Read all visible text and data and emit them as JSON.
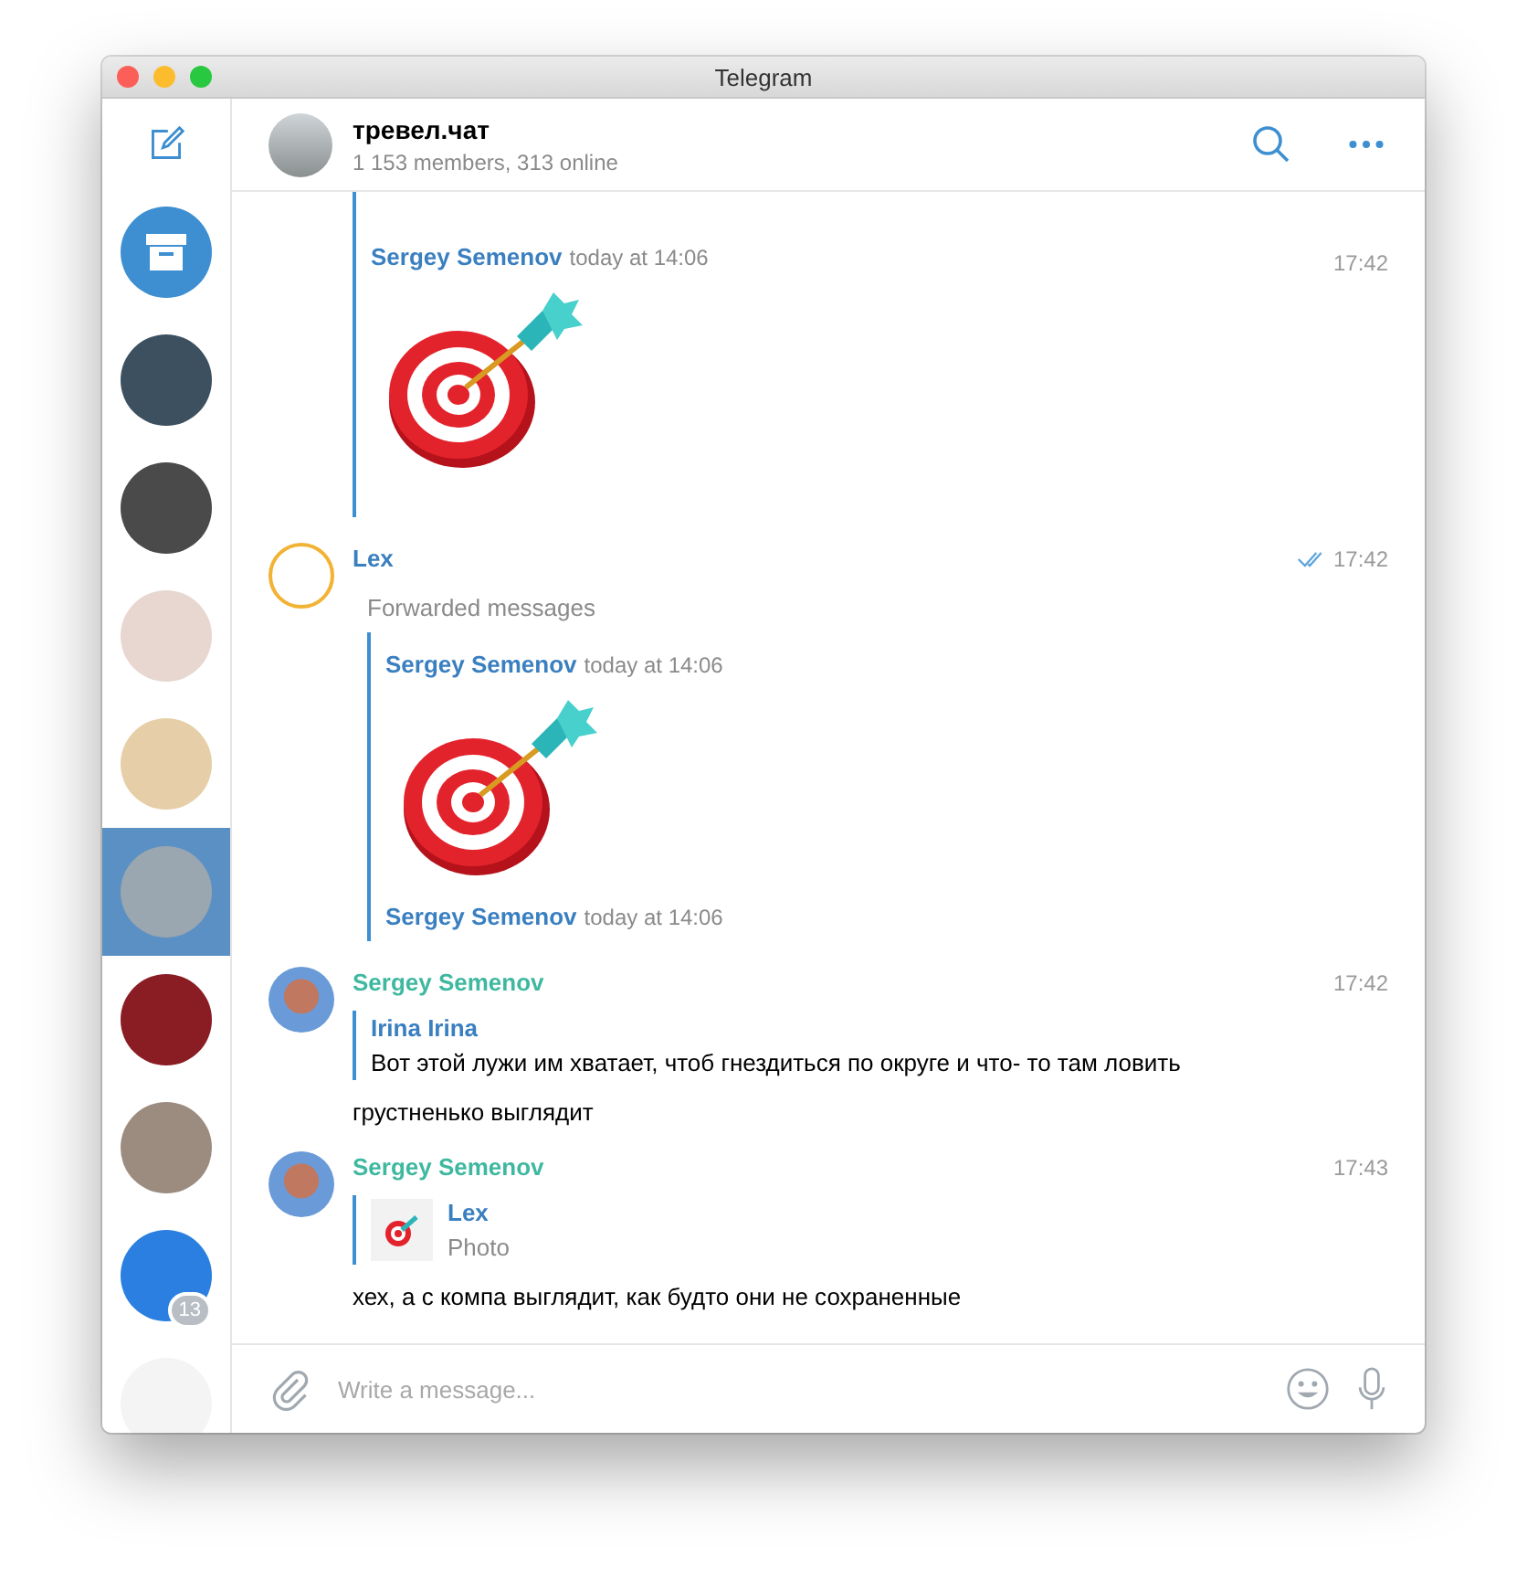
{
  "window": {
    "title": "Telegram"
  },
  "sidebar": {
    "chats": [
      {
        "selected": false,
        "color": "#3c5060"
      },
      {
        "selected": false,
        "color": "#4a4a4a"
      },
      {
        "selected": false,
        "color": "#e8d6d0"
      },
      {
        "selected": false,
        "color": "#e6cfa8"
      },
      {
        "selected": true,
        "color": "#9aa6b0"
      },
      {
        "selected": false,
        "color": "#8a1c24"
      },
      {
        "selected": false,
        "color": "#9c8c80"
      },
      {
        "selected": false,
        "color": "#2a7fe0",
        "badge": "13"
      },
      {
        "selected": false,
        "color": "#f4f4f4"
      }
    ]
  },
  "chat": {
    "title": "тревел.чат",
    "subtitle": "1 153 members, 313 online"
  },
  "messages": [
    {
      "time": "17:42",
      "forwards": [
        {
          "kind": "sticker",
          "author": "Sergey Semenov",
          "date": "today at 14:06"
        }
      ]
    },
    {
      "author": "Lex",
      "read": true,
      "time": "17:42",
      "caption": "Forwarded messages",
      "forwards": [
        {
          "kind": "sticker",
          "author": "Sergey Semenov",
          "date": "today at 14:06"
        },
        {
          "kind": "header",
          "author": "Sergey Semenov",
          "date": "today at 14:06"
        }
      ]
    },
    {
      "author": "Sergey Semenov",
      "time": "17:42",
      "reply": {
        "kind": "text",
        "author": "Irina Irina",
        "text": "Вот этой лужи им хватает, чтоб гнездиться по округе и что- то там ловить"
      },
      "text": "грустненько выглядит"
    },
    {
      "author": "Sergey Semenov",
      "time": "17:43",
      "reply": {
        "kind": "photo",
        "author": "Lex",
        "text": "Photo"
      },
      "text": "хех, а с компа выглядит, как будто они не сохраненные"
    }
  ],
  "composer": {
    "placeholder": "Write a message..."
  }
}
